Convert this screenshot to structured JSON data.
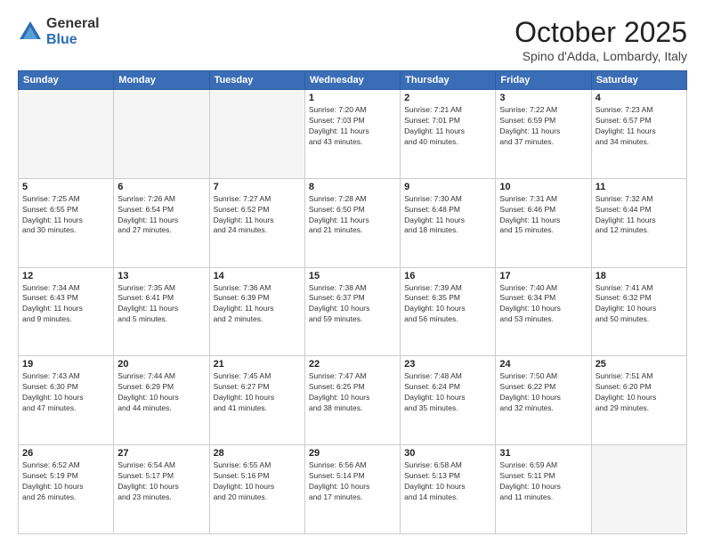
{
  "logo": {
    "general": "General",
    "blue": "Blue"
  },
  "title": "October 2025",
  "location": "Spino d'Adda, Lombardy, Italy",
  "weekdays": [
    "Sunday",
    "Monday",
    "Tuesday",
    "Wednesday",
    "Thursday",
    "Friday",
    "Saturday"
  ],
  "weeks": [
    [
      {
        "day": "",
        "empty": true
      },
      {
        "day": "",
        "empty": true
      },
      {
        "day": "",
        "empty": true
      },
      {
        "day": "1",
        "info": "Sunrise: 7:20 AM\nSunset: 7:03 PM\nDaylight: 11 hours\nand 43 minutes."
      },
      {
        "day": "2",
        "info": "Sunrise: 7:21 AM\nSunset: 7:01 PM\nDaylight: 11 hours\nand 40 minutes."
      },
      {
        "day": "3",
        "info": "Sunrise: 7:22 AM\nSunset: 6:59 PM\nDaylight: 11 hours\nand 37 minutes."
      },
      {
        "day": "4",
        "info": "Sunrise: 7:23 AM\nSunset: 6:57 PM\nDaylight: 11 hours\nand 34 minutes."
      }
    ],
    [
      {
        "day": "5",
        "info": "Sunrise: 7:25 AM\nSunset: 6:55 PM\nDaylight: 11 hours\nand 30 minutes."
      },
      {
        "day": "6",
        "info": "Sunrise: 7:26 AM\nSunset: 6:54 PM\nDaylight: 11 hours\nand 27 minutes."
      },
      {
        "day": "7",
        "info": "Sunrise: 7:27 AM\nSunset: 6:52 PM\nDaylight: 11 hours\nand 24 minutes."
      },
      {
        "day": "8",
        "info": "Sunrise: 7:28 AM\nSunset: 6:50 PM\nDaylight: 11 hours\nand 21 minutes."
      },
      {
        "day": "9",
        "info": "Sunrise: 7:30 AM\nSunset: 6:48 PM\nDaylight: 11 hours\nand 18 minutes."
      },
      {
        "day": "10",
        "info": "Sunrise: 7:31 AM\nSunset: 6:46 PM\nDaylight: 11 hours\nand 15 minutes."
      },
      {
        "day": "11",
        "info": "Sunrise: 7:32 AM\nSunset: 6:44 PM\nDaylight: 11 hours\nand 12 minutes."
      }
    ],
    [
      {
        "day": "12",
        "info": "Sunrise: 7:34 AM\nSunset: 6:43 PM\nDaylight: 11 hours\nand 9 minutes."
      },
      {
        "day": "13",
        "info": "Sunrise: 7:35 AM\nSunset: 6:41 PM\nDaylight: 11 hours\nand 5 minutes."
      },
      {
        "day": "14",
        "info": "Sunrise: 7:36 AM\nSunset: 6:39 PM\nDaylight: 11 hours\nand 2 minutes."
      },
      {
        "day": "15",
        "info": "Sunrise: 7:38 AM\nSunset: 6:37 PM\nDaylight: 10 hours\nand 59 minutes."
      },
      {
        "day": "16",
        "info": "Sunrise: 7:39 AM\nSunset: 6:35 PM\nDaylight: 10 hours\nand 56 minutes."
      },
      {
        "day": "17",
        "info": "Sunrise: 7:40 AM\nSunset: 6:34 PM\nDaylight: 10 hours\nand 53 minutes."
      },
      {
        "day": "18",
        "info": "Sunrise: 7:41 AM\nSunset: 6:32 PM\nDaylight: 10 hours\nand 50 minutes."
      }
    ],
    [
      {
        "day": "19",
        "info": "Sunrise: 7:43 AM\nSunset: 6:30 PM\nDaylight: 10 hours\nand 47 minutes."
      },
      {
        "day": "20",
        "info": "Sunrise: 7:44 AM\nSunset: 6:29 PM\nDaylight: 10 hours\nand 44 minutes."
      },
      {
        "day": "21",
        "info": "Sunrise: 7:45 AM\nSunset: 6:27 PM\nDaylight: 10 hours\nand 41 minutes."
      },
      {
        "day": "22",
        "info": "Sunrise: 7:47 AM\nSunset: 6:25 PM\nDaylight: 10 hours\nand 38 minutes."
      },
      {
        "day": "23",
        "info": "Sunrise: 7:48 AM\nSunset: 6:24 PM\nDaylight: 10 hours\nand 35 minutes."
      },
      {
        "day": "24",
        "info": "Sunrise: 7:50 AM\nSunset: 6:22 PM\nDaylight: 10 hours\nand 32 minutes."
      },
      {
        "day": "25",
        "info": "Sunrise: 7:51 AM\nSunset: 6:20 PM\nDaylight: 10 hours\nand 29 minutes."
      }
    ],
    [
      {
        "day": "26",
        "info": "Sunrise: 6:52 AM\nSunset: 5:19 PM\nDaylight: 10 hours\nand 26 minutes."
      },
      {
        "day": "27",
        "info": "Sunrise: 6:54 AM\nSunset: 5:17 PM\nDaylight: 10 hours\nand 23 minutes."
      },
      {
        "day": "28",
        "info": "Sunrise: 6:55 AM\nSunset: 5:16 PM\nDaylight: 10 hours\nand 20 minutes."
      },
      {
        "day": "29",
        "info": "Sunrise: 6:56 AM\nSunset: 5:14 PM\nDaylight: 10 hours\nand 17 minutes."
      },
      {
        "day": "30",
        "info": "Sunrise: 6:58 AM\nSunset: 5:13 PM\nDaylight: 10 hours\nand 14 minutes."
      },
      {
        "day": "31",
        "info": "Sunrise: 6:59 AM\nSunset: 5:11 PM\nDaylight: 10 hours\nand 11 minutes."
      },
      {
        "day": "",
        "empty": true
      }
    ]
  ]
}
